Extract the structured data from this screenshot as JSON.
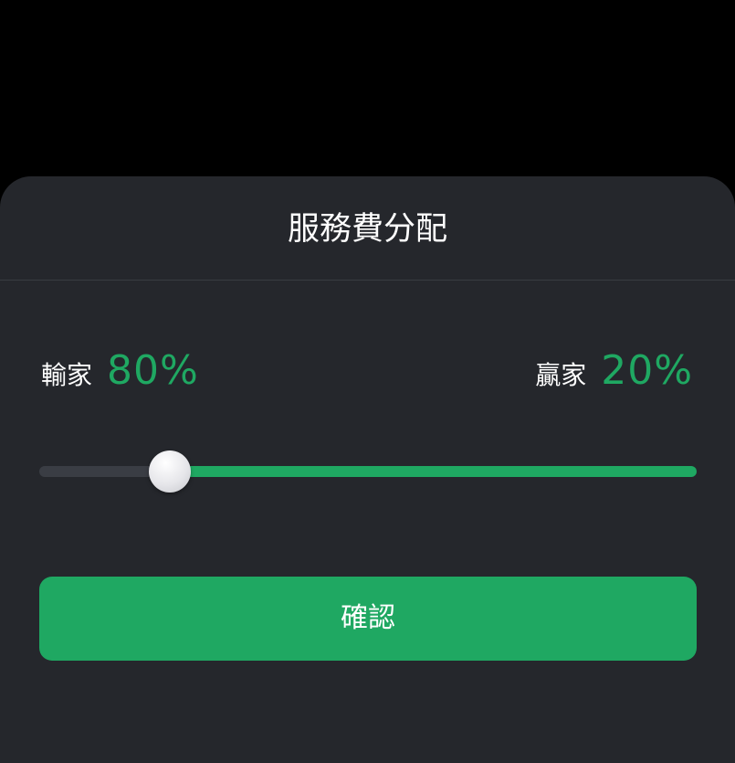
{
  "sheet": {
    "title": "服務費分配"
  },
  "split": {
    "loser_label": "輸家",
    "loser_value": "80%",
    "winner_label": "贏家",
    "winner_value": "20%",
    "slider_level_fraction": 0.2
  },
  "actions": {
    "confirm_label": "確認"
  },
  "colors": {
    "accent": "#1fa862",
    "sheet_background": "#25272c",
    "backdrop": "#000000"
  }
}
